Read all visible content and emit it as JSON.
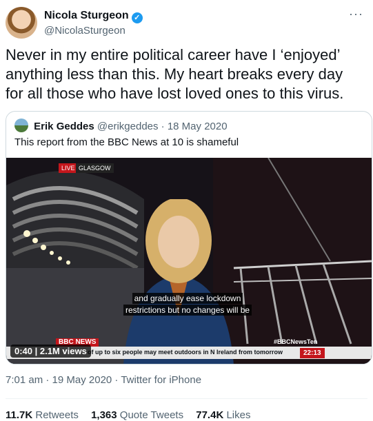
{
  "author": {
    "name": "Nicola Sturgeon",
    "handle": "@NicolaSturgeon",
    "verified_glyph": "✓"
  },
  "more_label": "···",
  "tweet": {
    "text": "Never in my entire political career have I ‘enjoyed’ anything less than this. My heart breaks every day for all those who have lost loved ones to this virus."
  },
  "quoted": {
    "name": "Erik Geddes",
    "handle": "@erikgeddes",
    "date": "· 18 May 2020",
    "text": "This report from the BBC News at 10 is shameful",
    "video": {
      "live_label": "LIVE",
      "location": "GLASGOW",
      "subtitle_line1": "and gradually ease lockdown",
      "subtitle_line2": "restrictions but no changes will be",
      "bbc_label": "BBC NEWS",
      "ticker_text": "of up to six people may meet outdoors in N Ireland from tomorrow",
      "hashtag": "#BBCNewsTen",
      "clock": "22:13",
      "duration": "0:40",
      "views": "2.1M views"
    }
  },
  "meta": {
    "timestamp": "7:01 am · 19 May 2020 · Twitter for iPhone"
  },
  "stats": {
    "retweets_count": "11.7K",
    "retweets_label": "Retweets",
    "quotes_count": "1,363",
    "quotes_label": "Quote Tweets",
    "likes_count": "77.4K",
    "likes_label": "Likes"
  },
  "colors": {
    "verified": "#1d9bf0",
    "bbc_red": "#c4161c",
    "secondary_text": "#536471"
  }
}
